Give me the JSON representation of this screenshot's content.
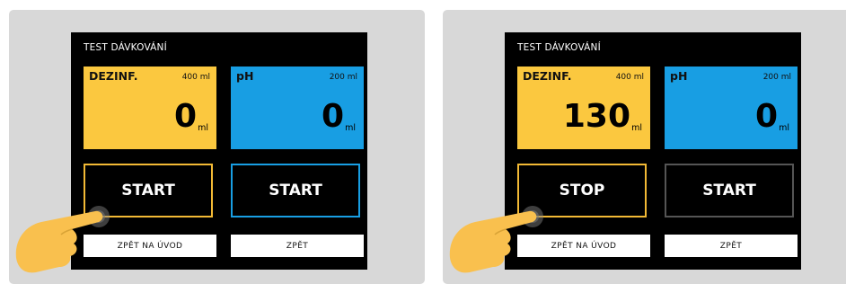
{
  "panels": [
    {
      "title": "TEST DÁVKOVÁNÍ",
      "dezinf": {
        "label": "DEZINF.",
        "capacity": "400 ml",
        "value": "0",
        "unit": "ml"
      },
      "ph": {
        "label": "pH",
        "capacity": "200 ml",
        "value": "0",
        "unit": "ml"
      },
      "left_button": "START",
      "right_button": "START",
      "back_home": "ZPĚT NA ÚVOD",
      "back": "ZPĚT"
    },
    {
      "title": "TEST DÁVKOVÁNÍ",
      "dezinf": {
        "label": "DEZINF.",
        "capacity": "400 ml",
        "value": "130",
        "unit": "ml"
      },
      "ph": {
        "label": "pH",
        "capacity": "200 ml",
        "value": "0",
        "unit": "ml"
      },
      "left_button": "STOP",
      "right_button": "START",
      "back_home": "ZPĚT NA ÚVOD",
      "back": "ZPĚT"
    }
  ],
  "colors": {
    "dezinf_tile": "#fbc83f",
    "ph_tile": "#189ee3",
    "active_border": "#f2b935",
    "ph_border": "#189ee3",
    "disabled_border": "#555555",
    "hand": "#f9c04e"
  },
  "icons": {
    "hand": "pointing-hand-icon"
  }
}
